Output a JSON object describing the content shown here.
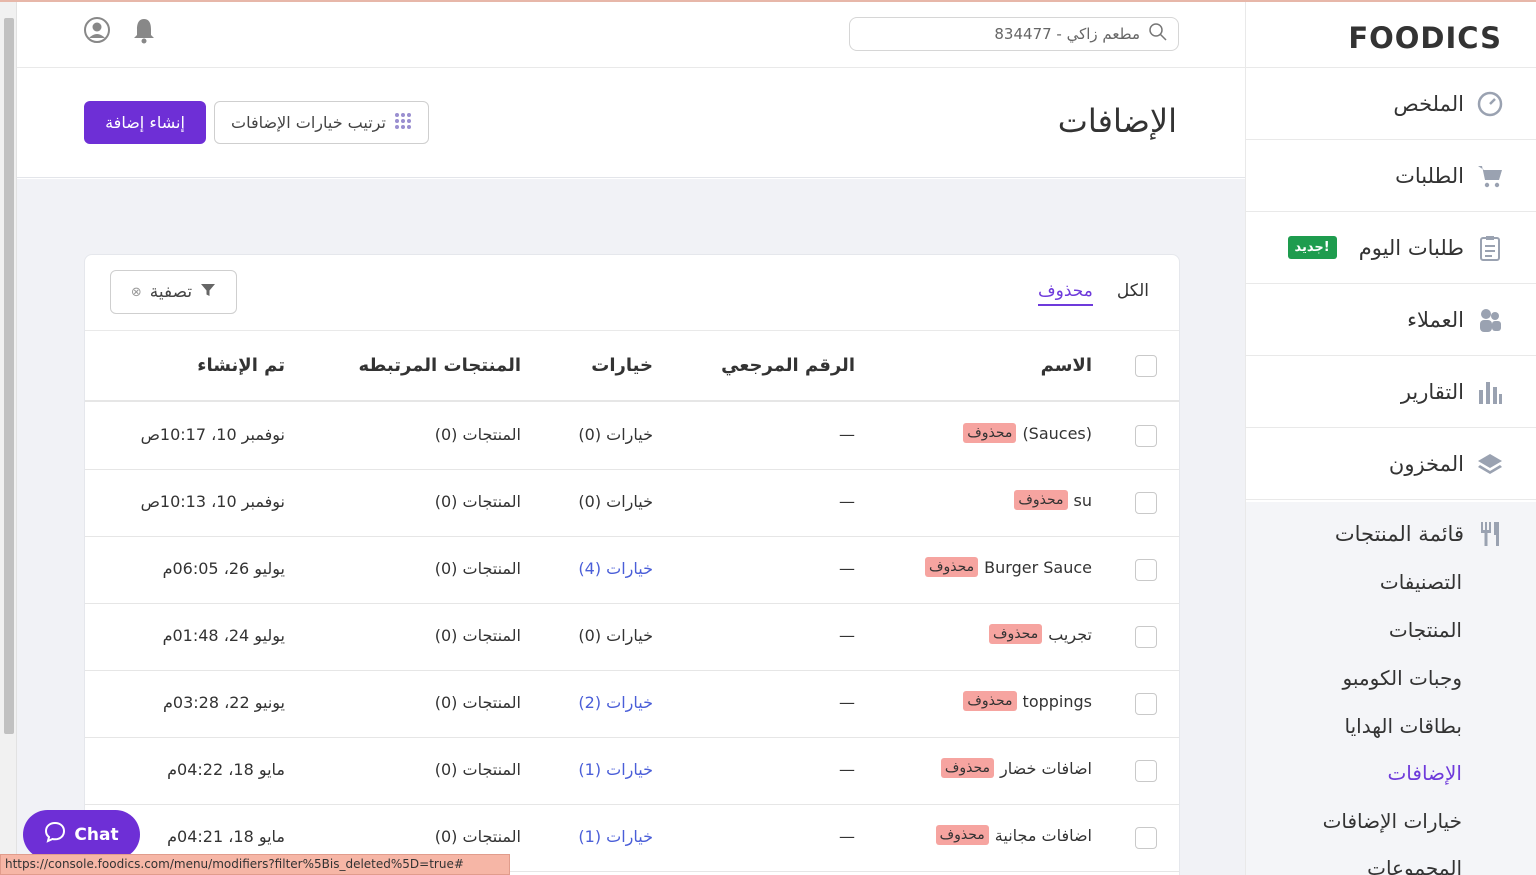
{
  "app": {
    "logo": "FOODICS"
  },
  "topbar": {
    "search_value": "مطعم زاكي - 834477"
  },
  "sidebar": {
    "items": [
      {
        "label": "الملخص",
        "icon": "dashboard-icon"
      },
      {
        "label": "الطلبات",
        "icon": "cart-icon"
      },
      {
        "label": "طلبات اليوم",
        "icon": "clipboard-icon",
        "badge": "جديد!"
      },
      {
        "label": "العملاء",
        "icon": "customers-icon"
      },
      {
        "label": "التقارير",
        "icon": "reports-icon"
      },
      {
        "label": "المخزون",
        "icon": "layers-icon"
      }
    ],
    "menu_section": {
      "title": "قائمة المنتجات",
      "items": [
        "التصنيفات",
        "المنتجات",
        "وجبات الكومبو",
        "بطاقات الهدايا",
        "الإضافات",
        "خيارات الإضافات",
        "المجموعات"
      ],
      "active": "الإضافات"
    }
  },
  "page": {
    "title": "الإضافات",
    "create_button": "إنشاء إضافة",
    "sort_button": "ترتيب خيارات الإضافات"
  },
  "tabs": {
    "all": "الكل",
    "deleted": "محذوف"
  },
  "filter": {
    "label": "تصفية"
  },
  "table": {
    "headers": {
      "name": "الاسم",
      "reference": "الرقم المرجعي",
      "options": "خيارات",
      "products": "المنتجات المرتبطه",
      "created": "تم الإنشاء"
    },
    "badge_label": "محذوف",
    "rows": [
      {
        "name": "(Sauces)",
        "reference": "—",
        "options": "خيارات (0)",
        "options_link": false,
        "products": "المنتجات (0)",
        "created": "نوفمبر 10، 10:17ص"
      },
      {
        "name": "su",
        "reference": "—",
        "options": "خيارات (0)",
        "options_link": false,
        "products": "المنتجات (0)",
        "created": "نوفمبر 10، 10:13ص"
      },
      {
        "name": "Burger Sauce",
        "reference": "—",
        "options": "خيارات (4)",
        "options_link": true,
        "products": "المنتجات (0)",
        "created": "يوليو 26، 06:05م"
      },
      {
        "name": "تجريب",
        "reference": "—",
        "options": "خيارات (0)",
        "options_link": false,
        "products": "المنتجات (0)",
        "created": "يوليو 24، 01:48م"
      },
      {
        "name": "toppings",
        "reference": "—",
        "options": "خيارات (2)",
        "options_link": true,
        "products": "المنتجات (0)",
        "created": "يونيو 22، 03:28م"
      },
      {
        "name": "اضافات خضار",
        "reference": "—",
        "options": "خيارات (1)",
        "options_link": true,
        "products": "المنتجات (0)",
        "created": "مايو 18، 04:22م"
      },
      {
        "name": "اضافات مجانية",
        "reference": "—",
        "options": "خيارات (1)",
        "options_link": true,
        "products": "المنتجات (0)",
        "created": "مايو 18، 04:21م"
      }
    ]
  },
  "chat": {
    "label": "Chat"
  },
  "status_bar": {
    "url": "https://console.foodics.com/menu/modifiers?filter%5Bis_deleted%5D=true#"
  },
  "colors": {
    "accent": "#6e2fd6",
    "badge_deleted": "#f6a4a0",
    "badge_new": "#1e9c4e",
    "link": "#4a5ed8"
  }
}
